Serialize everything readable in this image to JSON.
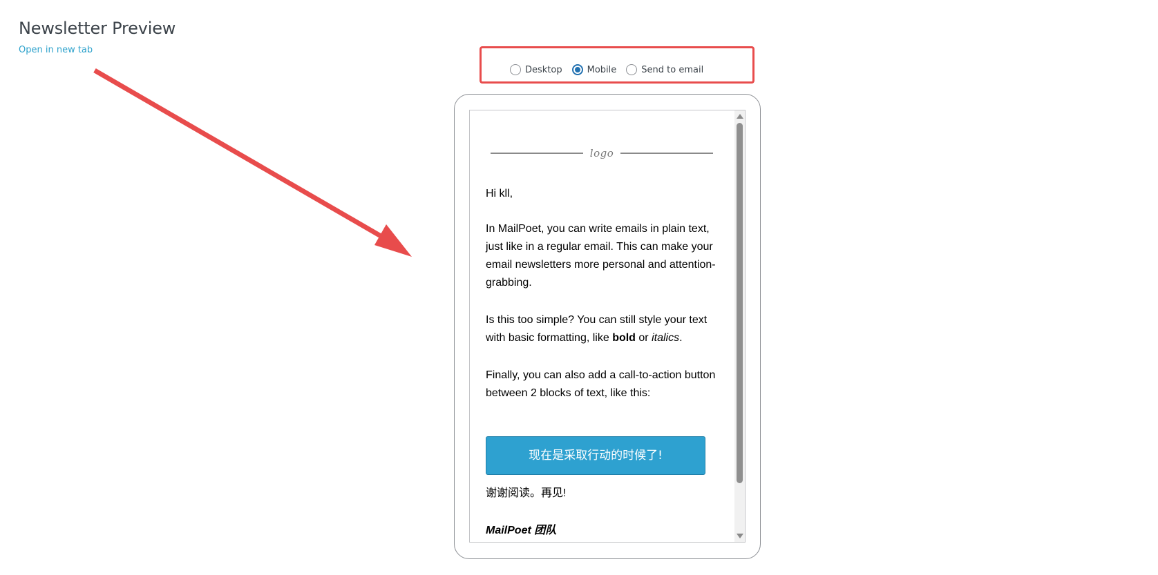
{
  "header": {
    "title": "Newsletter Preview",
    "open_link": "Open in new tab"
  },
  "preview_modes": {
    "options": [
      "Desktop",
      "Mobile",
      "Send to email"
    ],
    "selected": "Mobile"
  },
  "colors": {
    "annotation": "#e84c4c",
    "link": "#2ea2cc",
    "cta_background": "#2ea1d0",
    "radio_checked": "#2271b1"
  },
  "email": {
    "logo": "logo",
    "greeting": "Hi kll,",
    "para1": "In MailPoet, you can write emails in plain text, just like in a regular email. This can make your email newsletters more personal and attention-grabbing.",
    "para2_start": "Is this too simple? You can still style your text with basic formatting, like ",
    "para2_bold": "bold",
    "para2_mid": " or ",
    "para2_italic": "italics",
    "para2_end": ".",
    "para3": "Finally, you can also add a call-to-action button between 2 blocks of text, like this:",
    "cta_label": "现在是采取行动的时候了!",
    "closing": "谢谢阅读。再见!",
    "signature": "MailPoet 团队"
  }
}
